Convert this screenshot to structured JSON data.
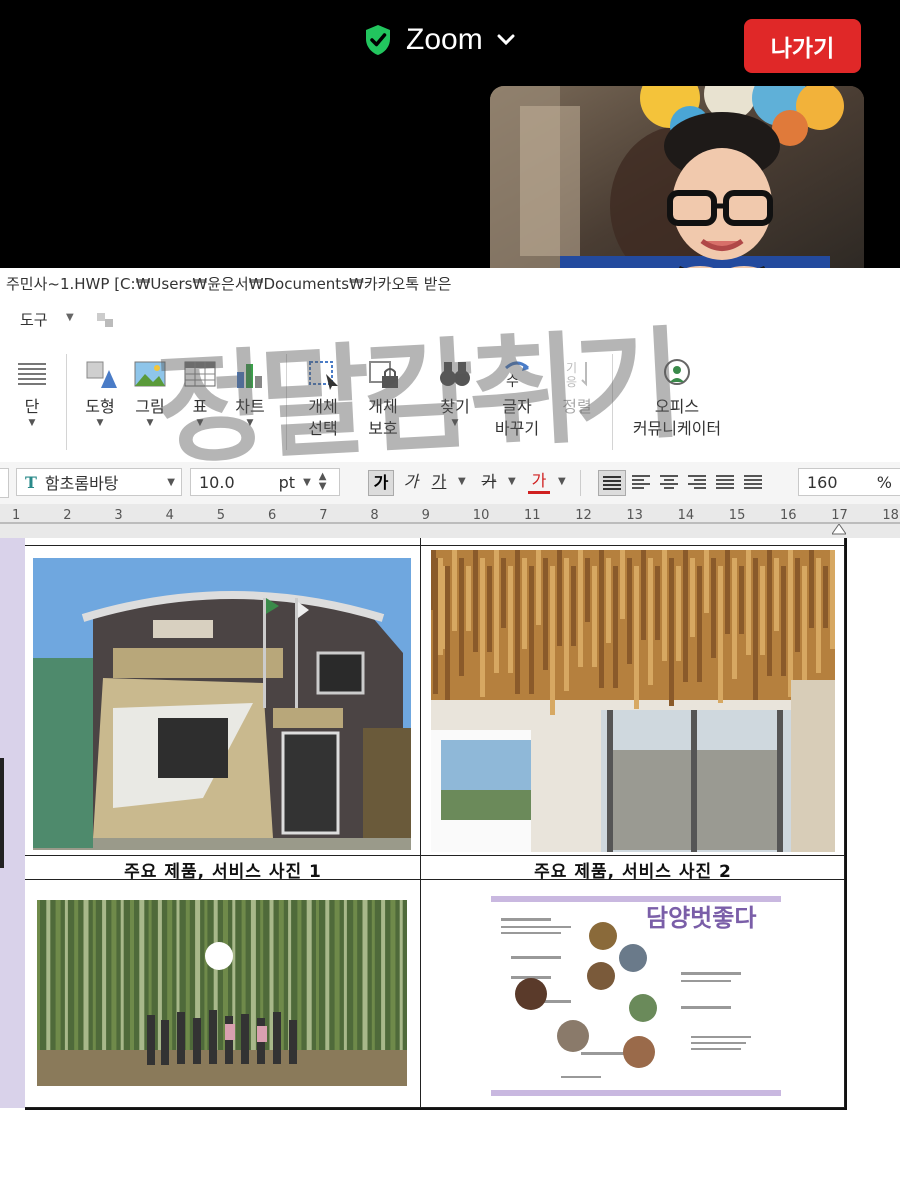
{
  "zoom": {
    "title": "Zoom",
    "exit_label": "나가기"
  },
  "window": {
    "title": "주민사~1.HWP [C:₩Users₩윤은서₩Documents₩카카오톡 받은"
  },
  "menu": {
    "tools": "도구"
  },
  "ribbon": {
    "dan": "단",
    "shape": "도형",
    "picture": "그림",
    "table": "표",
    "chart": "차트",
    "object_select_1": "개체",
    "object_select_2": "선택",
    "object_protect_1": "개체",
    "object_protect_2": "보호",
    "find": "찾기",
    "char_change_1": "글자",
    "char_change_2": "바꾸기",
    "sort": "정렬",
    "office_1": "오피스",
    "office_2": "커뮤니케이터"
  },
  "format": {
    "font": "함초롬바탕",
    "size": "10.0",
    "unit": "pt",
    "zoom_value": "160",
    "zoom_unit": "%",
    "ga1": "가",
    "ga2": "가",
    "ga3": "가",
    "ga4": "가",
    "ga5": "가"
  },
  "ruler": [
    "1",
    "2",
    "3",
    "4",
    "5",
    "6",
    "7",
    "8",
    "9",
    "10",
    "11",
    "12",
    "13",
    "14",
    "15",
    "16",
    "17",
    "18"
  ],
  "document": {
    "caption_1": "주요 제품, 서비스 사진 1",
    "caption_2": "주요 제품, 서비스 사진 2",
    "poster_title": "담양벗좋다"
  },
  "watermark": "정말감취기",
  "colors": {
    "exit": "#e02828",
    "shield": "#22c55e",
    "purple": "#7a5ea8"
  }
}
